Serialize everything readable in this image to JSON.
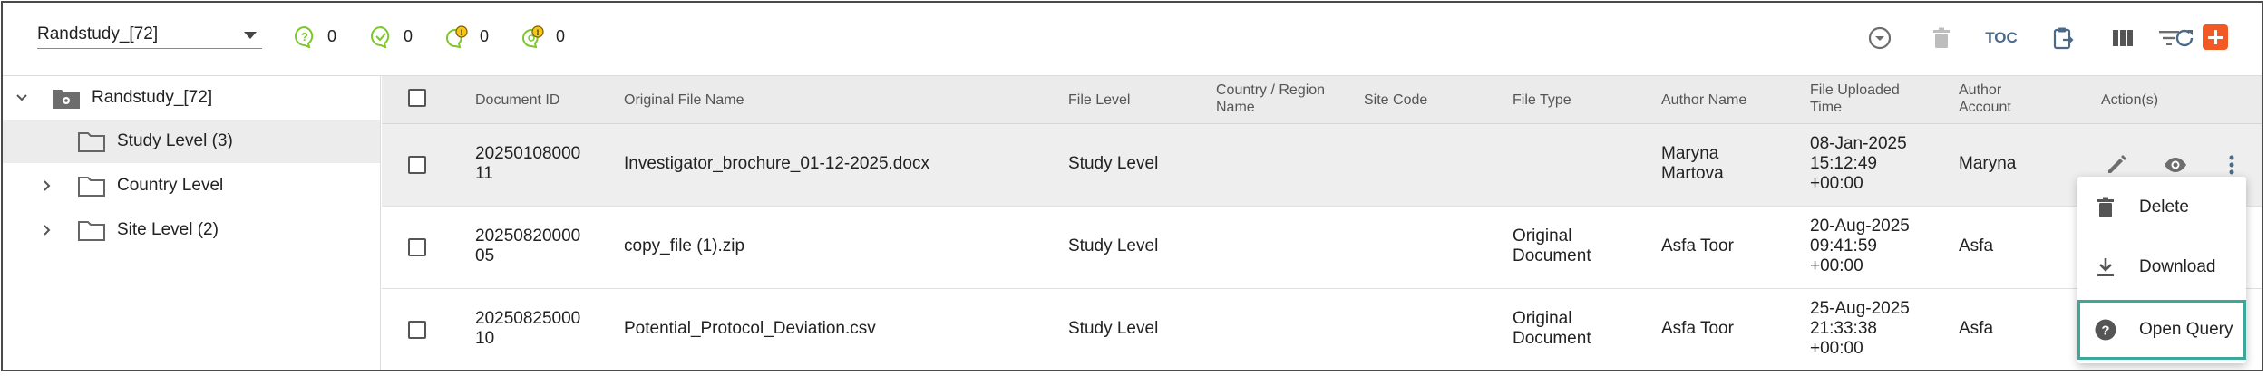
{
  "study_selector": {
    "value": "Randstudy_[72]"
  },
  "status_counts": [
    {
      "icon": "question-circle-icon",
      "count": "0",
      "color": "#7cc72b"
    },
    {
      "icon": "check-chat-icon",
      "count": "0",
      "color": "#7cc72b"
    },
    {
      "icon": "alert-chat-icon",
      "count": "0",
      "color": "#7cc72b"
    },
    {
      "icon": "alert-chat-cog-icon",
      "count": "0",
      "color": "#7cc72b"
    }
  ],
  "toolbar": {
    "toc_label": "TOC",
    "icons": [
      "circle-down-icon",
      "trash-icon",
      "toc-icon",
      "clipboard-icon",
      "columns-icon",
      "refresh-icon",
      "filter-icon",
      "add-icon"
    ],
    "accent": "#f15a24"
  },
  "tree": {
    "root": "Randstudy_[72]",
    "items": [
      {
        "label": "Study Level (3)",
        "selected": true
      },
      {
        "label": "Country Level",
        "selected": false
      },
      {
        "label": "Site Level (2)",
        "selected": false
      }
    ]
  },
  "table": {
    "headers": {
      "doc_id": "Document ID",
      "file_name": "Original File Name",
      "file_level": "File Level",
      "country_1": "Country / Region",
      "country_2": "Name",
      "site_code": "Site Code",
      "file_type": "File Type",
      "author_name": "Author Name",
      "uploaded_1": "File Uploaded",
      "uploaded_2": "Time",
      "account_1": "Author",
      "account_2": "Account",
      "actions": "Action(s)"
    },
    "rows": [
      {
        "doc_id_1": "20250108000",
        "doc_id_2": "11",
        "file_name": "Investigator_brochure_01-12-2025.docx",
        "file_level": "Study Level",
        "file_type_1": "",
        "file_type_2": "",
        "author_1": "Maryna",
        "author_2": "Martova",
        "time_1": "08-Jan-2025",
        "time_2": "15:12:49",
        "time_3": "+00:00",
        "account": "Maryna"
      },
      {
        "doc_id_1": "20250820000",
        "doc_id_2": "05",
        "file_name": "copy_file (1).zip",
        "file_level": "Study Level",
        "file_type_1": "Original",
        "file_type_2": "Document",
        "author_1": "Asfa Toor",
        "author_2": "",
        "time_1": "20-Aug-2025",
        "time_2": "09:41:59",
        "time_3": "+00:00",
        "account": "Asfa"
      },
      {
        "doc_id_1": "20250825000",
        "doc_id_2": "10",
        "file_name": "Potential_Protocol_Deviation.csv",
        "file_level": "Study Level",
        "file_type_1": "Original",
        "file_type_2": "Document",
        "author_1": "Asfa Toor",
        "author_2": "",
        "time_1": "25-Aug-2025",
        "time_2": "21:33:38",
        "time_3": "+00:00",
        "account": "Asfa"
      }
    ]
  },
  "row_menu": {
    "items": [
      {
        "label": "Delete",
        "icon": "trash-icon"
      },
      {
        "label": "Download",
        "icon": "download-icon"
      },
      {
        "label": "Open Query",
        "icon": "question-circle-icon",
        "focused": true
      }
    ],
    "focus_color": "#3fa79a"
  }
}
